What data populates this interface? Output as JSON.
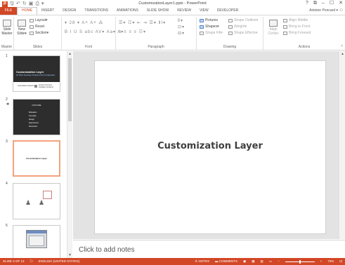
{
  "window": {
    "title": "CustomizationLayer1.pptx - PowerPoint",
    "app_icon": "P",
    "controls": [
      "?",
      "⧉",
      "–",
      "☐",
      "✕"
    ]
  },
  "quick_access": [
    {
      "name": "save-icon",
      "glyph": "🖫"
    },
    {
      "name": "undo-icon",
      "glyph": "↶"
    },
    {
      "name": "redo-icon",
      "glyph": "↻"
    },
    {
      "name": "presentation-icon",
      "glyph": "▣"
    },
    {
      "name": "print-icon",
      "glyph": "⎙"
    },
    {
      "name": "customize-icon",
      "glyph": "▾"
    }
  ],
  "tabs": {
    "file": "FILE",
    "items": [
      "HOME",
      "INSERT",
      "DESIGN",
      "TRANSITIONS",
      "ANIMATIONS",
      "SLIDE SHOW",
      "REVIEW",
      "VIEW",
      "DEVELOPER"
    ],
    "active": "HOME",
    "user": "Antoine Poncard ▾"
  },
  "ribbon": {
    "groups": {
      "master": "Master",
      "slides": "Slides",
      "font": "Font",
      "paragraph": "Paragraph",
      "drawing": "Drawing",
      "actions": "Actions"
    },
    "slide_master": "Slide Master",
    "new_slide": "New Slide▾",
    "layout": "Layout▾",
    "reset": "Reset",
    "section": "Section▾",
    "font_row1": "▾ 28 ▾ A˄ A˅ ⁂",
    "font_row2": "B I U S abc AV▾ Aa▾ A▾",
    "para_row1": "☰▾ ☷▾ ⇤ ⇥ ☰▾ ⅡⅠ▾",
    "para_row2": "≡ ≡ ≡ ≡ ☷▾",
    "para_col3": [
      "Ⅱ▾",
      "⊡▾",
      "⊟▾"
    ],
    "pictures": "Pictures",
    "shapes": "Shapes▾",
    "shape_fill": "Shape Fill▾",
    "shape_outline": "Shape Outline▾",
    "weight": "Weight▾",
    "shape_effects": "Shape Effects▾",
    "align_center": "Align Center",
    "align_middle": "Align Middle",
    "bring_to_front": "Bring to Front",
    "bring_forward": "Bring Forward"
  },
  "slides": [
    {
      "num": "1",
      "title": "Customization Layer",
      "subtitle": "for Office Developer Programs (DC) Configuration",
      "band_logo": "Insta Adobe Systems",
      "band_text": "Antoine Poncard · Intelligent Systems"
    },
    {
      "num": "2",
      "title": "OUTLINE",
      "bullets": [
        "Motivation",
        "Concepts",
        "Design",
        "Experiments",
        "Discussion"
      ]
    },
    {
      "num": "3",
      "title": "Customization Layer"
    },
    {
      "num": "4"
    },
    {
      "num": "5"
    }
  ],
  "main_slide": {
    "title": "Customization Layer"
  },
  "notes": {
    "placeholder": "Click to add notes"
  },
  "status": {
    "slide_of": "SLIDE 3 OF 13",
    "language": "ENGLISH (UNITED STATES)",
    "notes": "NOTES",
    "comments": "COMMENTS",
    "zoom": "75%"
  },
  "colors": {
    "accent": "#d24726",
    "selected_thumb": "#f4a27d",
    "dark_slide": "#2d2d2d"
  }
}
